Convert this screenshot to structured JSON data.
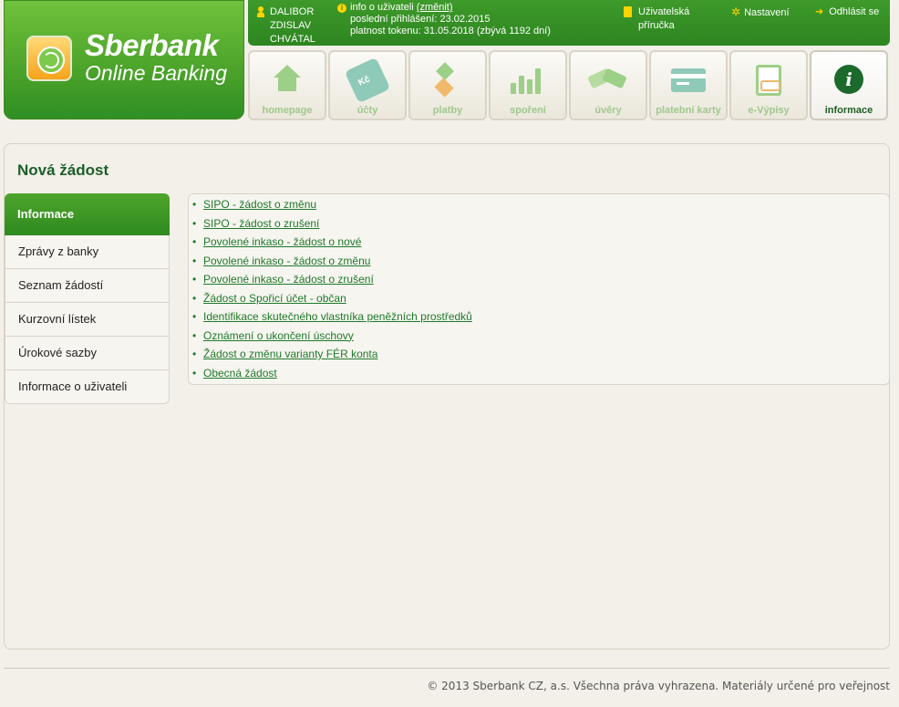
{
  "brand": {
    "name": "Sberbank",
    "subtitle": "Online Banking"
  },
  "topbar": {
    "user_name_lines": [
      "DALIBOR",
      "ZDISLAV",
      "CHVÁTAL"
    ],
    "info_label": "info o uživateli",
    "change_link": "(změnit)",
    "last_login": "poslední přihlášení: 23.02.2015",
    "token_validity": "platnost tokenu: 31.05.2018 (zbývá 1192 dní)",
    "manual_lines": [
      "Uživatelská",
      "příručka"
    ],
    "settings": "Nastavení",
    "logout": "Odhlásit se"
  },
  "tabs": [
    {
      "label": "homepage",
      "icon": "home-icon"
    },
    {
      "label": "účty",
      "icon": "accounts-tag-icon"
    },
    {
      "label": "platby",
      "icon": "payments-icon"
    },
    {
      "label": "spoření",
      "icon": "savings-chart-icon"
    },
    {
      "label": "úvěry",
      "icon": "handshake-icon"
    },
    {
      "label": "platební karty",
      "icon": "card-icon"
    },
    {
      "label": "e-Výpisy",
      "icon": "statement-doc-icon"
    },
    {
      "label": "informace",
      "icon": "info-icon",
      "active": true
    }
  ],
  "page": {
    "title": "Nová žádost"
  },
  "sidemenu": [
    {
      "label": "Informace",
      "active": true
    },
    {
      "label": "Zprávy z banky"
    },
    {
      "label": "Seznam žádostí"
    },
    {
      "label": "Kurzovní lístek"
    },
    {
      "label": "Úrokové sazby"
    },
    {
      "label": "Informace o uživateli"
    }
  ],
  "requests": [
    "SIPO - žádost o změnu",
    "SIPO - žádost o zrušení",
    "Povolené inkaso - žádost o nové",
    "Povolené inkaso - žádost o změnu",
    "Povolené inkaso - žádost o zrušení",
    "Žádost o Spořicí účet - občan",
    "Identifikace skutečného vlastníka peněžních prostředků",
    "Oznámení o ukončení úschovy",
    "Žádost o změnu varianty FÉR konta",
    "Obecná žádost"
  ],
  "footer": "© 2013 Sberbank CZ, a.s. Všechna práva vyhrazena. Materiály určené pro veřejnost",
  "colors": {
    "brand_green": "#2d8520",
    "accent_yellow": "#ffd400",
    "title_green": "#1b5e2a"
  }
}
